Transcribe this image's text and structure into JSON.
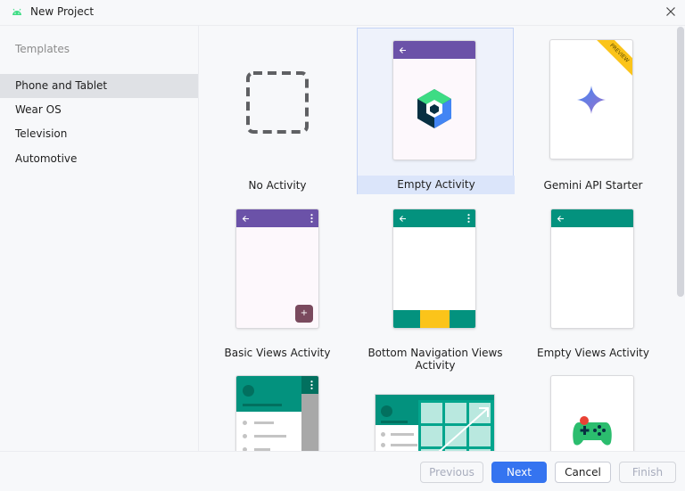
{
  "window": {
    "title": "New Project"
  },
  "sidebar": {
    "header": "Templates",
    "items": [
      {
        "label": "Phone and Tablet",
        "selected": true
      },
      {
        "label": "Wear OS",
        "selected": false
      },
      {
        "label": "Television",
        "selected": false
      },
      {
        "label": "Automotive",
        "selected": false
      }
    ]
  },
  "templates": [
    {
      "label": "No Activity",
      "selected": false
    },
    {
      "label": "Empty Activity",
      "selected": true
    },
    {
      "label": "Gemini API Starter",
      "selected": false,
      "badge": "PREVIEW"
    },
    {
      "label": "Basic Views Activity",
      "selected": false,
      "fab": "+"
    },
    {
      "label": "Bottom Navigation Views Activity",
      "selected": false
    },
    {
      "label": "Empty Views Activity",
      "selected": false
    }
  ],
  "footer": {
    "previous": "Previous",
    "next": "Next",
    "cancel": "Cancel",
    "finish": "Finish"
  },
  "colors": {
    "accent": "#3574f0",
    "purple": "#6b52a8",
    "teal": "#03927e",
    "yellow": "#fbc41a"
  }
}
